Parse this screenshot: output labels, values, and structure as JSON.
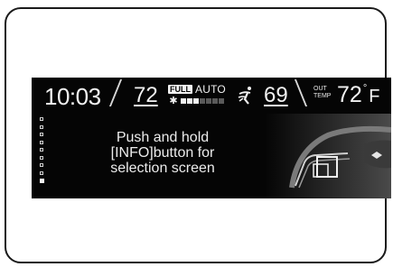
{
  "status_bar": {
    "clock": "10:03",
    "driver_set_temp": "72",
    "fan_full_badge": "FULL",
    "fan_mode": "AUTO",
    "fan_level": 0.43,
    "passenger_set_temp": "69",
    "outside_label_line1": "OUT",
    "outside_label_line2": "TEMP",
    "outside_temp": "72",
    "degree_symbol": "°",
    "temp_unit": "F"
  },
  "message": {
    "line1": "Push and hold",
    "line2": "[INFO]button for",
    "line3": "selection screen"
  },
  "page_indicator": {
    "total": 9,
    "active_index": 8
  },
  "icons": {
    "fan": "fan-icon",
    "airflow": "airflow-mode-icon",
    "steering_wheel": "steering-wheel-illustration"
  },
  "colors": {
    "display_background": "#050505",
    "display_text": "#f2f2f2",
    "frame_border": "#1a1a1a"
  }
}
